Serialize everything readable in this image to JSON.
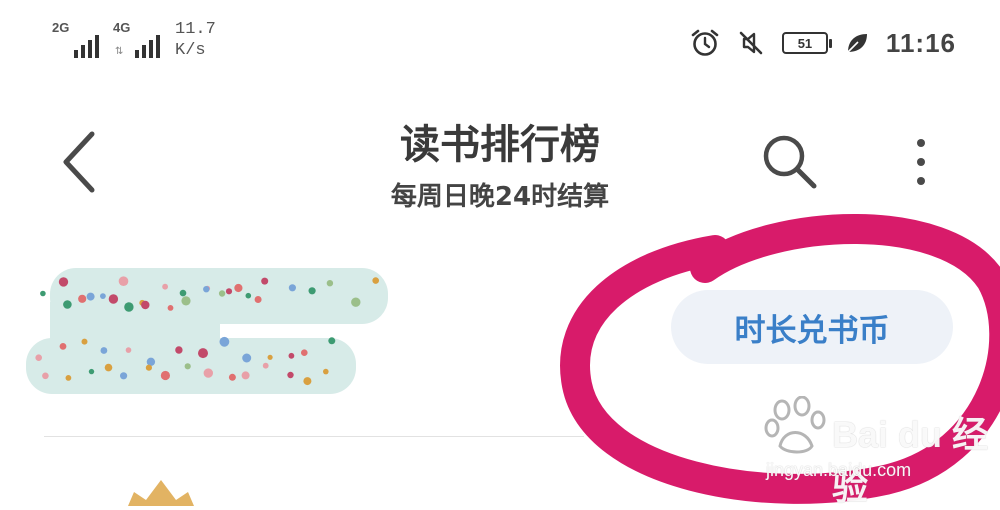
{
  "status_bar": {
    "sim1_network": "2G",
    "sim2_network": "4G",
    "data_speed_value": "11.7",
    "data_speed_unit": "K/s",
    "battery_level": "51",
    "time": "11:16",
    "icons": [
      "signal-icon",
      "signal-icon",
      "alarm-icon",
      "mute-icon",
      "battery-icon",
      "leaf-icon"
    ]
  },
  "header": {
    "title": "读书排行榜",
    "subtitle": "每周日晚24时结算",
    "icons": [
      "back-icon",
      "search-icon",
      "more-icon"
    ]
  },
  "actions": {
    "exchange_label": "时长兑书币"
  },
  "watermark": {
    "brand": "Bai du 经验",
    "url": "jingyan.baidu.com"
  },
  "colors": {
    "accent_blue": "#3a7fc8",
    "button_bg": "#eef2f8",
    "annotation_pink": "#d81b6a",
    "text_dark": "#3a3a3a"
  }
}
